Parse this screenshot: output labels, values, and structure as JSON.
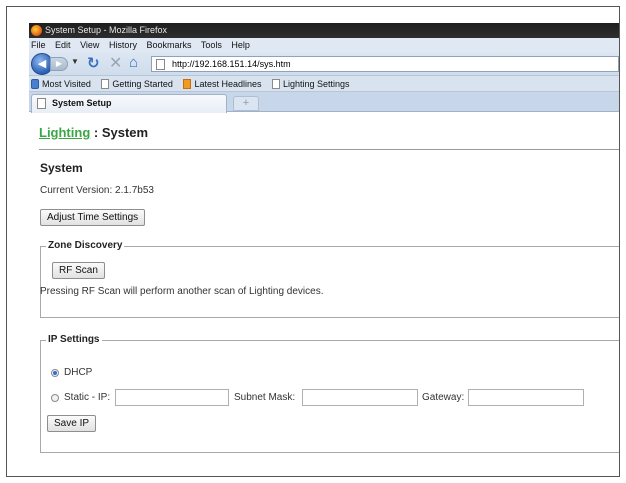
{
  "window": {
    "title": "System Setup - Mozilla Firefox"
  },
  "menu": [
    "File",
    "Edit",
    "View",
    "History",
    "Bookmarks",
    "Tools",
    "Help"
  ],
  "nav": {
    "url": "http://192.168.151.14/sys.htm"
  },
  "bookmarks": [
    "Most Visited",
    "Getting Started",
    "Latest Headlines",
    "Lighting Settings"
  ],
  "tab": {
    "label": "System Setup",
    "newtab": "+"
  },
  "page": {
    "crumb_link": "Lighting",
    "crumb_sep": " : ",
    "crumb_current": "System",
    "section_title": "System",
    "version_text": "Current Version: 2.1.7b53",
    "adjust_time_label": "Adjust Time Settings",
    "zone": {
      "legend": "Zone Discovery",
      "rf_scan_label": "RF Scan",
      "note": "Pressing RF Scan will perform another scan of Lighting devices."
    },
    "ip": {
      "legend": "IP Settings",
      "dhcp_label": "DHCP",
      "static_label": "Static - IP:",
      "static_ip_value": "",
      "subnet_label": "Subnet Mask:",
      "subnet_value": "",
      "gateway_label": "Gateway:",
      "gateway_value": "",
      "save_label": "Save IP",
      "selected": "DHCP"
    }
  }
}
